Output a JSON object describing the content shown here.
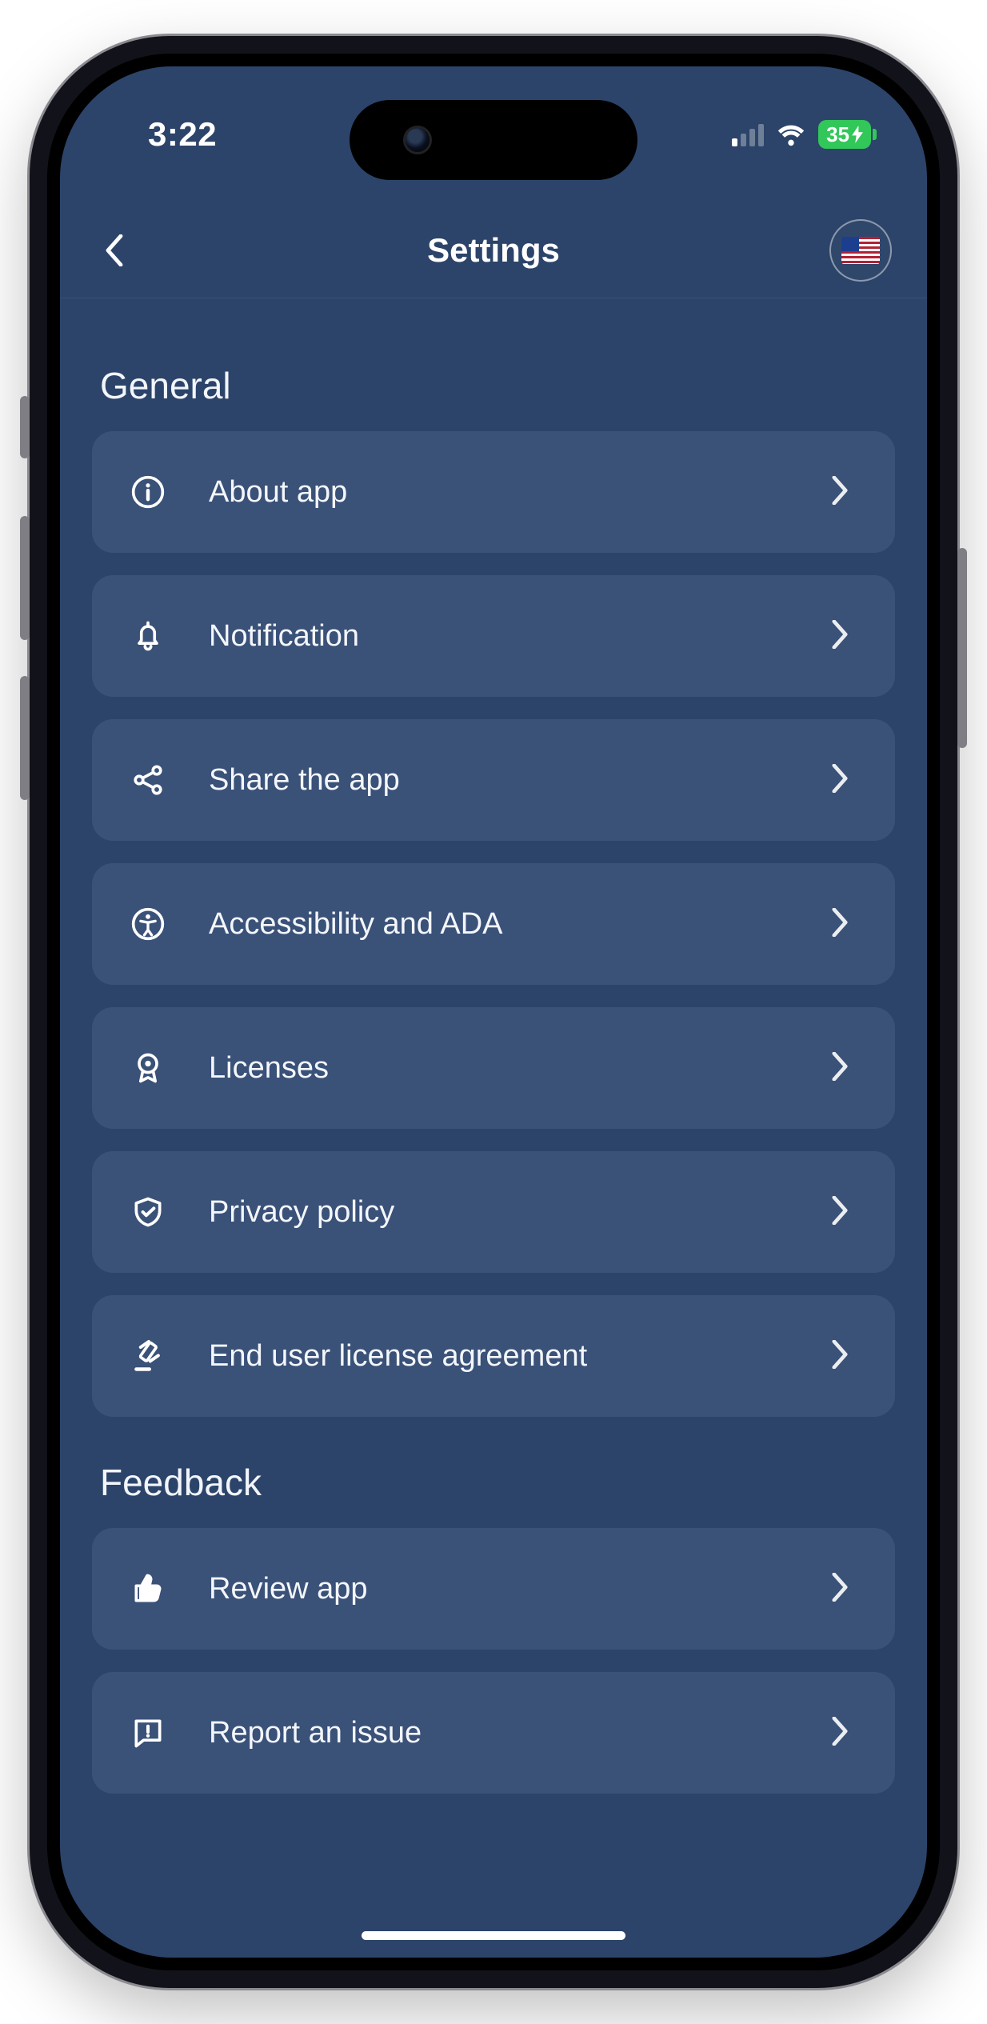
{
  "status_bar": {
    "time": "3:22",
    "battery_text": "35",
    "battery_color": "#32c759"
  },
  "header": {
    "title": "Settings",
    "locale_flag": "us"
  },
  "sections": [
    {
      "title": "General",
      "items": [
        {
          "icon": "info",
          "label": "About app"
        },
        {
          "icon": "bell",
          "label": "Notification"
        },
        {
          "icon": "share",
          "label": "Share the app"
        },
        {
          "icon": "accessibility",
          "label": "Accessibility and ADA"
        },
        {
          "icon": "badge",
          "label": "Licenses"
        },
        {
          "icon": "shield",
          "label": "Privacy policy"
        },
        {
          "icon": "gavel",
          "label": "End user license agreement"
        }
      ]
    },
    {
      "title": "Feedback",
      "items": [
        {
          "icon": "thumb",
          "label": "Review app"
        },
        {
          "icon": "report",
          "label": "Report an issue"
        }
      ]
    }
  ]
}
